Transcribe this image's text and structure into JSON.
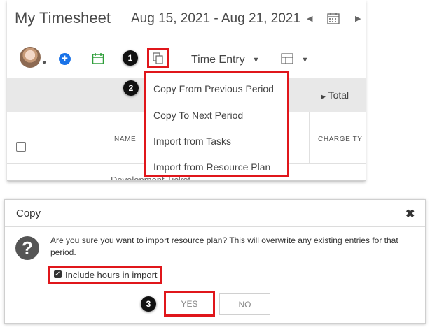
{
  "timesheet": {
    "title": "My Timesheet",
    "date_range": "Aug 15, 2021 - Aug 21, 2021",
    "toolbar": {
      "time_entry_label": "Time Entry"
    },
    "grid": {
      "total_label": "Total",
      "col_name": "NAME",
      "col_charge_type": "CHARGE TY",
      "row_text_cut": "Development Ticket"
    },
    "copy_menu": {
      "items": [
        "Copy From Previous Period",
        "Copy To Next Period",
        "Import from Tasks",
        "Import from Resource Plan"
      ]
    }
  },
  "dialog": {
    "title": "Copy",
    "message": "Are you sure you want to import resource plan? This will overwrite any existing entries for that period.",
    "include_hours_label": "Include hours in import",
    "include_hours_checked": true,
    "yes_label": "YES",
    "no_label": "NO"
  },
  "steps": [
    "1",
    "2",
    "3"
  ],
  "icons": {
    "prev": "chevron-left-icon",
    "calendar": "calendar-icon",
    "next": "chevron-right-icon",
    "add": "plus-circle-icon",
    "calendar_add": "calendar-add-icon",
    "copy": "copy-icon",
    "grid": "grid-layout-icon",
    "close": "close-icon",
    "question": "question-icon"
  },
  "colors": {
    "highlight": "#e0161b",
    "accent_blue": "#1a73e8",
    "accent_green": "#2e9e3a"
  }
}
